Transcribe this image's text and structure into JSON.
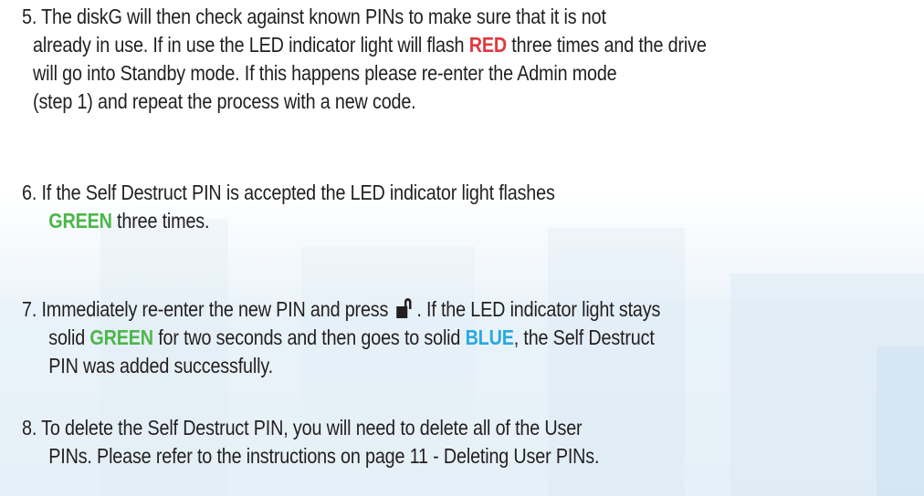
{
  "steps": [
    {
      "lines": [
        "5. The diskG will then check against known PINs to make sure that it is not",
        [
          "already in use. If in use the LED indicator light will flash ",
          "RED",
          " three times and the drive"
        ],
        "will go into Standby mode. If this happens please re-enter the Admin mode",
        "(step 1) and repeat the process with a new code."
      ]
    },
    {
      "lines": [
        "6. If the Self Destruct PIN is accepted the LED indicator light flashes",
        [
          "GREEN",
          " three times."
        ]
      ]
    },
    {
      "lines": [
        [
          "7. Immediately re-enter the new PIN and press ",
          ". If the LED indicator light stays"
        ],
        [
          "solid ",
          "GREEN",
          " for two seconds and then goes to solid ",
          "BLUE",
          ", the Self Destruct"
        ],
        "PIN was added successfully."
      ]
    },
    {
      "lines": [
        "8. To delete the Self Destruct PIN, you will need to delete all of the User",
        "PINs. Please refer to the instructions on page 11 - Deleting User PINs."
      ]
    }
  ],
  "icons": {
    "unlock": "unlock-icon"
  },
  "colors": {
    "red": "#e03a3e",
    "green": "#4cb748",
    "blue": "#29a8e0",
    "text": "#231f20"
  }
}
